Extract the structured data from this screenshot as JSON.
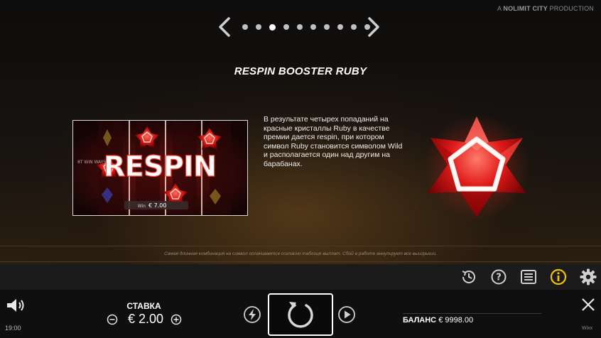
{
  "header": {
    "producer_prefix": "A",
    "producer_brand": "NOLIMIT CITY",
    "producer_suffix": "PRODUCTION"
  },
  "pager": {
    "total_pages": 10,
    "active_page": 3
  },
  "page": {
    "title": "RESPIN BOOSTER RUBY",
    "description": "В результате четырех попаданий на красные кристаллы Ruby в качестве премии дается respin, при котором символ Ruby становится символом Wild и располагается один над другим на барабанах.",
    "preview": {
      "logo_text": "RESPIN",
      "win_label": "Win",
      "win_value": "€ 7.00",
      "side_text": "8T WIN WAYS"
    },
    "footnote": "Самая длинная комбинация на символ оплачивается согласно таблице выплат. Сбой в работе аннулирует все выигрыши."
  },
  "toolbar": {
    "icons": [
      "history-icon",
      "help-icon",
      "paytable-icon",
      "info-icon",
      "settings-icon"
    ],
    "active_color": "#f2c200"
  },
  "bottom": {
    "bet_label": "СТАВКА",
    "bet_value": "€ 2.00",
    "balance_label": "БАЛАНС",
    "balance_value": "€ 9998.00",
    "time": "19:00",
    "brand": "Wixx"
  },
  "colors": {
    "ruby": "#e01a1a",
    "accent_yellow": "#f2c200"
  }
}
